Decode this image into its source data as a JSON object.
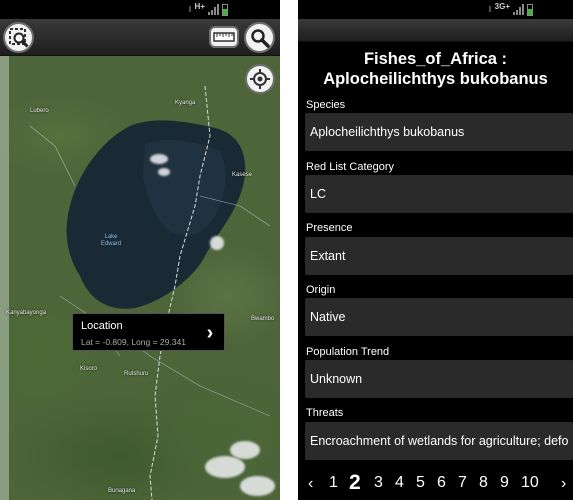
{
  "left_screen": {
    "status_bar": {
      "network": "H+",
      "battery_color": "#3fb63f"
    },
    "toolbar": {
      "zoom_icon": "zoom-area-icon",
      "ruler_icon": "ruler-icon",
      "search_icon": "search-icon"
    },
    "map": {
      "place_labels": [
        "Lubero",
        "Kyanga",
        "Kasese",
        "Lake Edward",
        "Kanyabayonga",
        "Bwambo",
        "Kisoro",
        "Rutshuru",
        "Bunagana"
      ],
      "locate_icon": "crosshair-icon",
      "callout": {
        "title": "Location",
        "coords": "Lat = -0.809, Long = 29.341",
        "arrow_icon": "chevron-right-icon"
      }
    }
  },
  "right_screen": {
    "status_bar": {
      "network": "3G+",
      "battery_color": "#3fb63f"
    },
    "title": "Fishes_of_Africa : Aplocheilichthys bukobanus",
    "fields": [
      {
        "label": "Species",
        "value": "Aplocheilichthys bukobanus"
      },
      {
        "label": "Red List Category",
        "value": "LC"
      },
      {
        "label": "Presence",
        "value": "Extant"
      },
      {
        "label": "Origin",
        "value": "Native"
      },
      {
        "label": "Population Trend",
        "value": "Unknown"
      },
      {
        "label": "Threats",
        "value": "Encroachment of wetlands for agriculture; defo"
      }
    ],
    "pager": {
      "prev": "‹",
      "next": "›",
      "pages": [
        "1",
        "2",
        "3",
        "4",
        "5",
        "6",
        "7",
        "8",
        "9",
        "10"
      ],
      "current": "2"
    }
  }
}
